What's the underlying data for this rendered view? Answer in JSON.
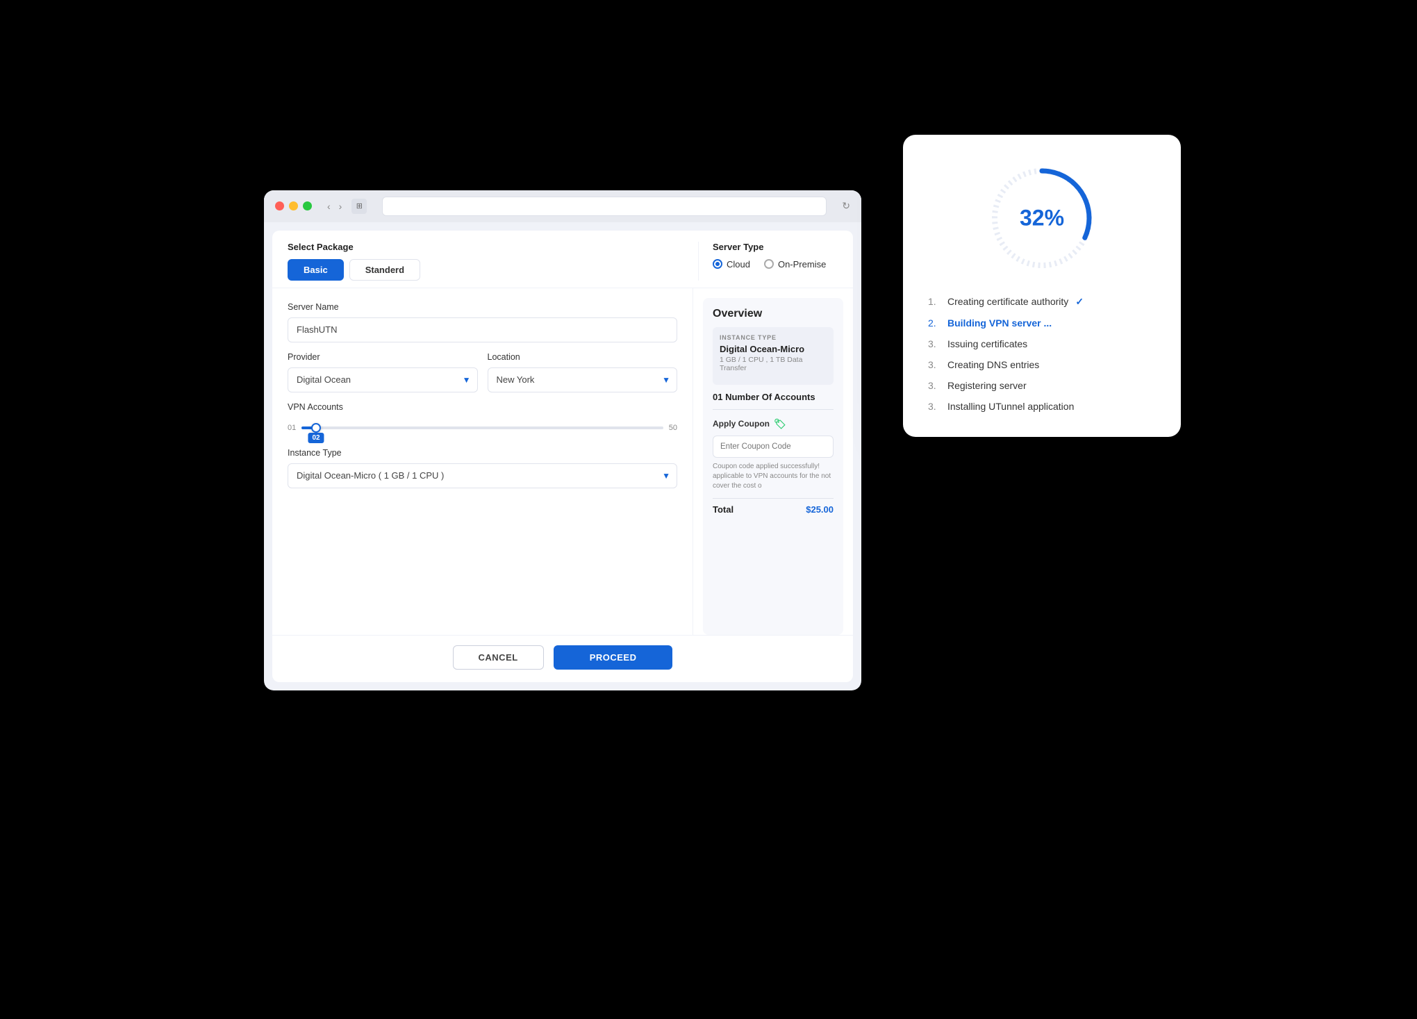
{
  "browser": {
    "title": ""
  },
  "form": {
    "select_package_label": "Select Package",
    "basic_label": "Basic",
    "standard_label": "Standerd",
    "server_type_label": "Server Type",
    "cloud_label": "Cloud",
    "on_premise_label": "On-Premise",
    "server_name_label": "Server Name",
    "server_name_value": "FlashUTN",
    "provider_label": "Provider",
    "provider_value": "Digital Ocean",
    "location_label": "Location",
    "location_value": "New York",
    "vpn_accounts_label": "VPN Accounts",
    "slider_min": "01",
    "slider_max": "50",
    "slider_value": "02",
    "instance_type_label": "Instance Type",
    "instance_type_value": "Digital Ocean-Micro ( 1 GB / 1 CPU )",
    "cancel_label": "CANCEL",
    "proceed_label": "PROCEED"
  },
  "overview": {
    "title": "Overview",
    "instance_type_sublabel": "INSTANCE TYPE",
    "instance_name": "Digital Ocean-Micro",
    "instance_specs": "1 GB / 1 CPU , 1 TB Data Transfer",
    "accounts_label": "01 Number Of Accounts",
    "apply_coupon_label": "Apply Coupon",
    "coupon_placeholder": "Enter Coupon Code",
    "coupon_success": "Coupon code applied successfully! applicable to VPN accounts for the not cover the cost o",
    "total_label": "Total",
    "total_amount": "$25.00"
  },
  "progress": {
    "percent": "32%",
    "steps": [
      {
        "number": "1.",
        "text": "Creating certificate authority",
        "status": "done"
      },
      {
        "number": "2.",
        "text": "Building VPN server ...",
        "status": "active"
      },
      {
        "number": "3.",
        "text": "Issuing certificates",
        "status": "pending"
      },
      {
        "number": "3.",
        "text": "Creating DNS entries",
        "status": "pending"
      },
      {
        "number": "3.",
        "text": "Registering server",
        "status": "pending"
      },
      {
        "number": "3.",
        "text": "Installing UTunnel application",
        "status": "pending"
      }
    ]
  }
}
